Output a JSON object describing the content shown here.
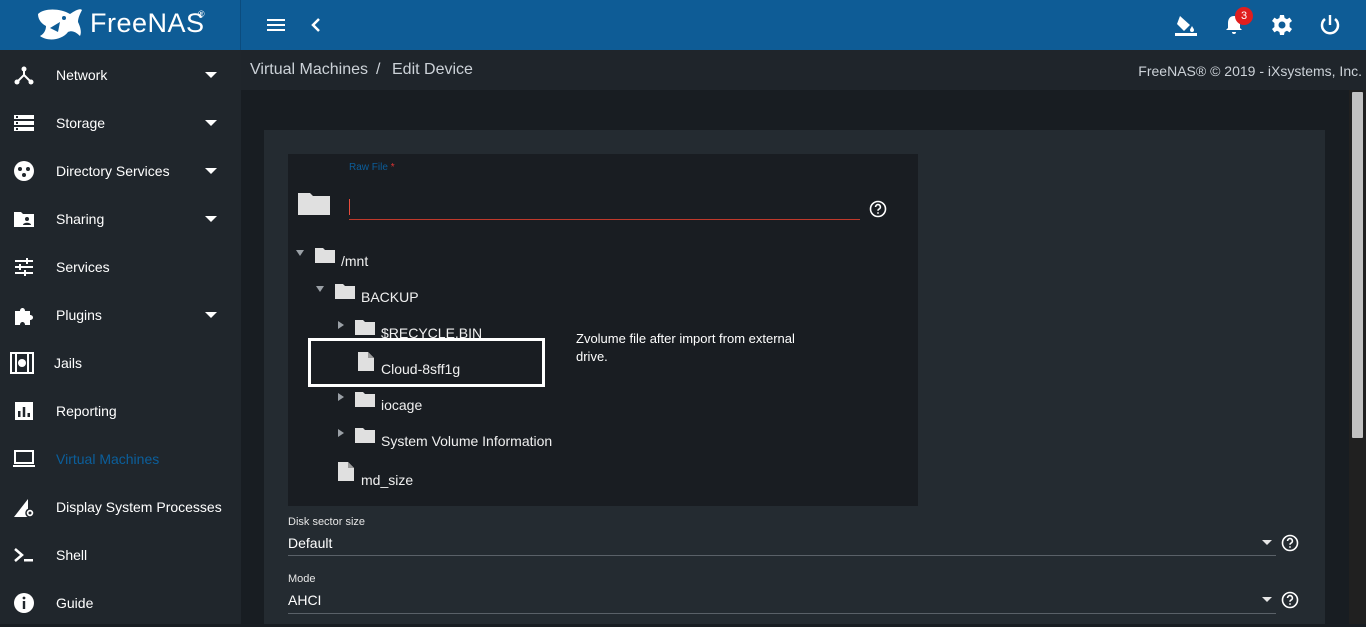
{
  "header": {
    "logo_text": "FreeNAS",
    "logo_reg": "®",
    "notification_count": "3",
    "icons": [
      "menu-icon",
      "chevron-left-icon",
      "theme-bucket-icon",
      "bell-icon",
      "gear-icon",
      "power-icon"
    ]
  },
  "sidebar": {
    "items": [
      {
        "label": "Network",
        "icon": "network-icon",
        "has_caret": true
      },
      {
        "label": "Storage",
        "icon": "storage-icon",
        "has_caret": true
      },
      {
        "label": "Directory Services",
        "icon": "directory-services-icon",
        "has_caret": true
      },
      {
        "label": "Sharing",
        "icon": "sharing-folder-icon",
        "has_caret": true
      },
      {
        "label": "Services",
        "icon": "sliders-icon",
        "has_caret": false
      },
      {
        "label": "Plugins",
        "icon": "puzzle-icon",
        "has_caret": true
      },
      {
        "label": "Jails",
        "icon": "jail-icon",
        "has_caret": false
      },
      {
        "label": "Reporting",
        "icon": "bar-chart-icon",
        "has_caret": false
      },
      {
        "label": "Virtual Machines",
        "icon": "laptop-icon",
        "has_caret": false,
        "active": true
      },
      {
        "label": "Display System Processes",
        "icon": "processes-icon",
        "has_caret": false
      },
      {
        "label": "Shell",
        "icon": "shell-icon",
        "has_caret": false
      },
      {
        "label": "Guide",
        "icon": "info-icon",
        "has_caret": false
      }
    ],
    "active_color": "#0b5f9c"
  },
  "breadcrumb": {
    "parent": "Virtual Machines",
    "separator": "/",
    "current": "Edit Device",
    "copyright": "FreeNAS® © 2019 - iXsystems, Inc."
  },
  "form": {
    "raw_file": {
      "label": "Raw File",
      "required_mark": "*",
      "value": ""
    },
    "tree": {
      "mnt": "/mnt",
      "backup": "BACKUP",
      "recycle": "$RECYCLE.BIN",
      "cloud": "Cloud-8sff1g",
      "iocage": "iocage",
      "sysvol": "System Volume Information",
      "md_size": "md_size"
    },
    "annotation": "Zvolume file after import from external drive.",
    "disk_sector": {
      "label": "Disk sector size",
      "value": "Default"
    },
    "mode": {
      "label": "Mode",
      "value": "AHCI"
    }
  }
}
